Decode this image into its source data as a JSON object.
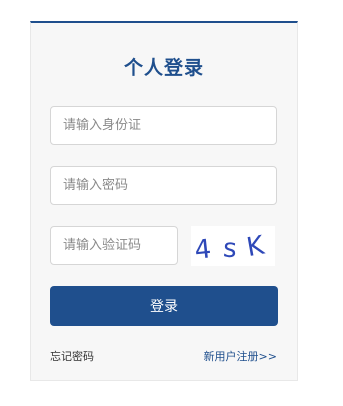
{
  "login": {
    "title": "个人登录",
    "id_placeholder": "请输入身份证",
    "password_placeholder": "请输入密码",
    "captcha_placeholder": "请输入验证码",
    "captcha_text": [
      "4",
      "s",
      "K"
    ],
    "submit_label": "登录",
    "forgot_label": "忘记密码",
    "register_label": "新用户注册>>"
  },
  "colors": {
    "accent": "#1f4f8d",
    "captcha_ink": "#2e48b8"
  }
}
